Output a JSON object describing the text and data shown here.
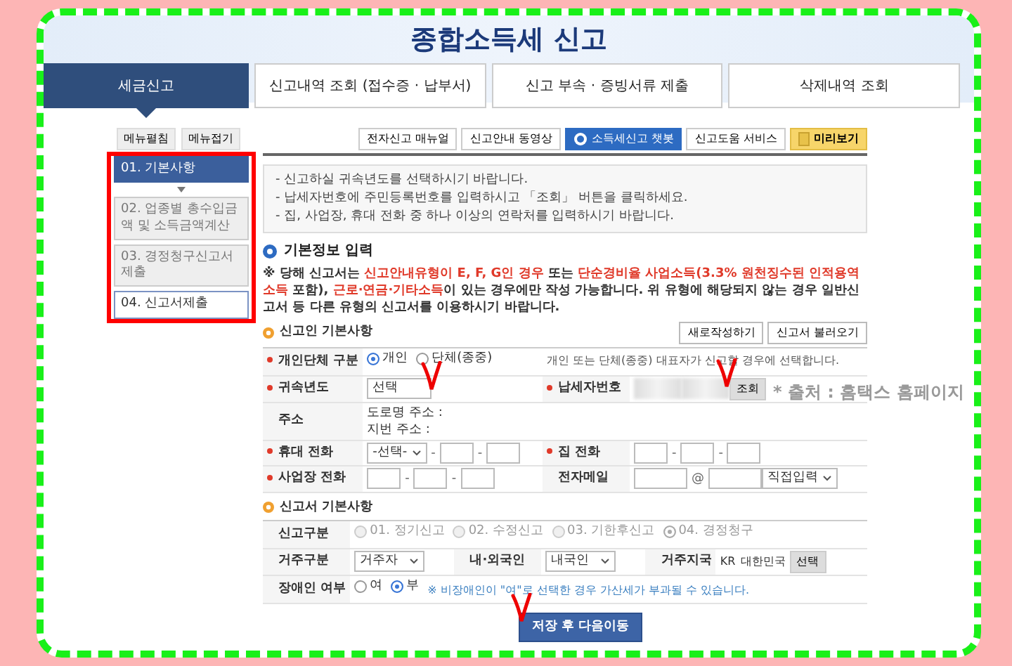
{
  "header": {
    "title": "종합소득세 신고"
  },
  "tabs": [
    {
      "label": "세금신고",
      "selected": true
    },
    {
      "label": "신고내역 조회 (접수증 · 납부서)",
      "selected": false
    },
    {
      "label": "신고 부속 · 증빙서류 제출",
      "selected": false
    },
    {
      "label": "삭제내역 조회",
      "selected": false
    }
  ],
  "side_menu": {
    "buttons": [
      "메뉴펼침",
      "메뉴접기"
    ],
    "steps": [
      {
        "label": "01. 기본사항",
        "selected": true
      },
      {
        "label": "02. 업종별 총수입금액 및 소득금액계산",
        "selected": false
      },
      {
        "label": "03. 경정청구신고서 제출",
        "selected": false
      },
      {
        "label": "04. 신고서제출",
        "selected": false
      }
    ]
  },
  "toolbar": [
    {
      "label": "전자신고 매뉴얼",
      "kind": "plain"
    },
    {
      "label": "신고안내 동영상",
      "kind": "plain"
    },
    {
      "label": "소득세신고 챗봇",
      "kind": "chatbot"
    },
    {
      "label": "신고도움 서비스",
      "kind": "plain"
    },
    {
      "label": "미리보기",
      "kind": "preview"
    }
  ],
  "guide": [
    "- 신고하실 귀속년도를 선택하시기 바랍니다.",
    "- 납세자번호에 주민등록번호를 입력하시고 「조회」 버튼을 클릭하세요.",
    "- 집, 사업장, 휴대 전화 중 하나 이상의 연락처를 입력하시기 바랍니다."
  ],
  "section_title": "기본정보 입력",
  "notice": [
    {
      "text": "※ 당해 신고서는 ",
      "highlight": false
    },
    {
      "text": "신고안내유형이 E, F, G인 경우",
      "highlight": true
    },
    {
      "text": " 또는 ",
      "highlight": false
    },
    {
      "text": "단순경비율 사업소득(3.3% 원천징수된 인적용역소득",
      "highlight": true
    },
    {
      "text": " 포함), ",
      "highlight": false
    },
    {
      "text": "근로·연금·기타소득",
      "highlight": true
    },
    {
      "text": "이 있는 경우에만 작성 가능합니다. 위 유형에 해당되지 않는 경우 일반신고서 등 다른 유형의 신고서를 이용하시기 바랍니다.",
      "highlight": false
    }
  ],
  "reporter": {
    "title": "신고인 기본사항",
    "buttons": [
      "새로작성하기",
      "신고서 불러오기"
    ],
    "type_row": {
      "label": "개인단체 구분",
      "required": true,
      "options": [
        {
          "label": "개인",
          "selected": true
        },
        {
          "label": "단체(종중)",
          "selected": false
        }
      ],
      "hint": "개인 또는 단체(종중) 대표자가 신고할 경우에 선택합니다."
    },
    "year": {
      "label": "귀속년도",
      "required": true,
      "value": "선택"
    },
    "taxpayer_no": {
      "label": "납세자번호",
      "required": true,
      "button": "조회"
    },
    "address": {
      "label": "주소",
      "required": false,
      "lines": [
        "도로명 주소 :",
        "지번 주소 :"
      ]
    },
    "mobile": {
      "label": "휴대 전화",
      "required": true,
      "select": "-선택-",
      "separators": [
        "-",
        "-"
      ]
    },
    "home": {
      "label": "집 전화",
      "required": true,
      "separators": [
        "-",
        "-"
      ]
    },
    "office": {
      "label": "사업장 전화",
      "required": true,
      "separators": [
        "-",
        "-"
      ]
    },
    "email": {
      "label": "전자메일",
      "required": false,
      "at": "@",
      "domain": "직접입력"
    }
  },
  "report": {
    "title": "신고서 기본사항",
    "report_type": {
      "label": "신고구분",
      "disabled": true,
      "options": [
        {
          "label": "01. 정기신고",
          "selected": false
        },
        {
          "label": "02. 수정신고",
          "selected": false
        },
        {
          "label": "03. 기한후신고",
          "selected": false
        },
        {
          "label": "04. 경정청구",
          "selected": true
        }
      ]
    },
    "residence": {
      "label": "거주구분",
      "value": "거주자"
    },
    "nationality": {
      "label": "내·외국인",
      "value": "내국인"
    },
    "country": {
      "label": "거주지국",
      "code": "KR",
      "name": "대한민국",
      "button": "선택"
    },
    "disability": {
      "label": "장애인 여부",
      "options": [
        {
          "label": "여",
          "selected": false
        },
        {
          "label": "부",
          "selected": true
        }
      ],
      "note": "※ 비장애인이 \"여\"로 선택한 경우 가산세가 부과될 수 있습니다."
    }
  },
  "save_button": "저장 후 다음이동",
  "source_note": "* 출처 : 홈택스 홈페이지"
}
